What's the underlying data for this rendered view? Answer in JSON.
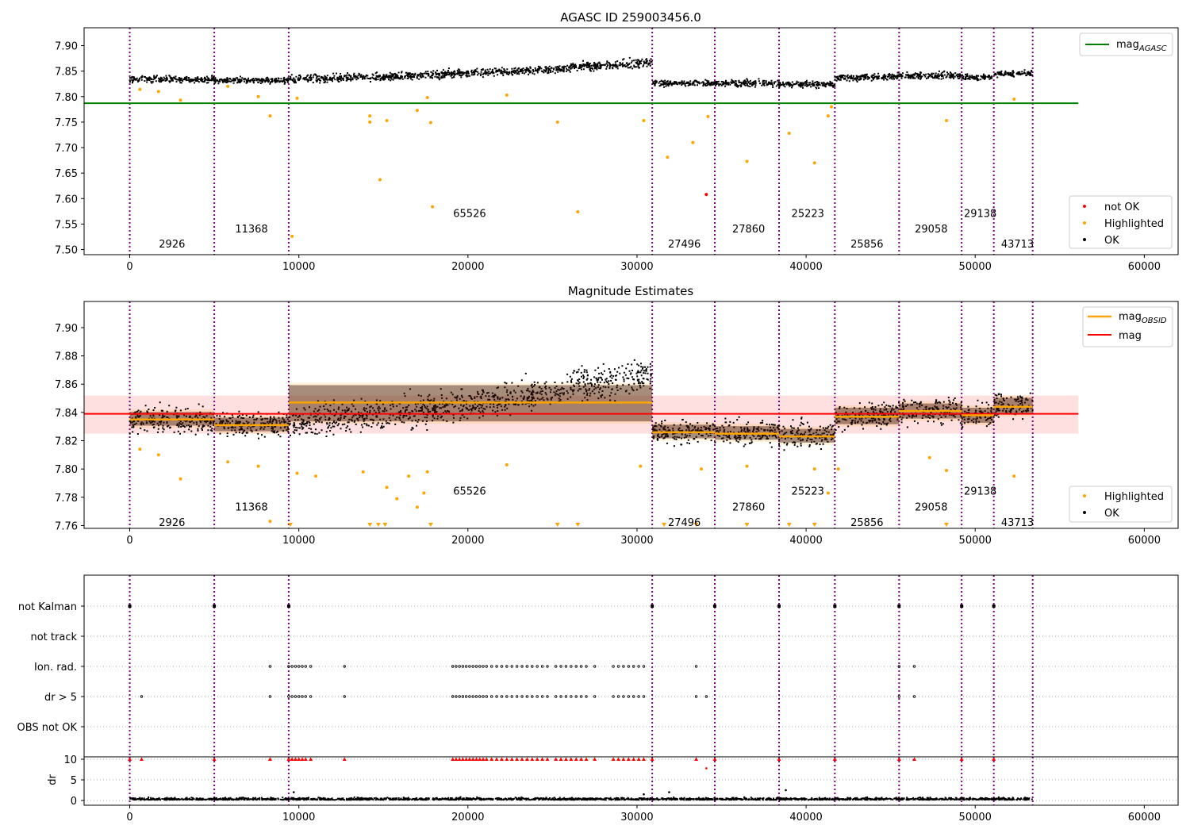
{
  "figure": {
    "panel1_title": "AGASC ID 259003456.0",
    "panel2_title": "Magnitude Estimates",
    "x_ticks": [
      0,
      10000,
      20000,
      30000,
      40000,
      50000,
      60000
    ]
  },
  "chart_data": [
    {
      "type": "scatter",
      "title": "AGASC ID 259003456.0",
      "xlim": [
        -2700,
        62000
      ],
      "ylim": [
        7.49,
        7.935
      ],
      "y_ticks": [
        "7.50",
        "7.55",
        "7.60",
        "7.65",
        "7.70",
        "7.75",
        "7.80",
        "7.85",
        "7.90"
      ],
      "mag_agasc": 7.787,
      "obs_boundaries": [
        0,
        5000,
        9400,
        30900,
        34600,
        38400,
        41700,
        45500,
        49200,
        51100,
        53400
      ],
      "obs_labels": [
        {
          "text": "2926",
          "x": 2500,
          "y": 7.51
        },
        {
          "text": "11368",
          "x": 7200,
          "y": 7.54
        },
        {
          "text": "65526",
          "x": 20100,
          "y": 7.57
        },
        {
          "text": "27496",
          "x": 32800,
          "y": 7.51
        },
        {
          "text": "27860",
          "x": 36600,
          "y": 7.54
        },
        {
          "text": "25223",
          "x": 40100,
          "y": 7.57
        },
        {
          "text": "25856",
          "x": 43600,
          "y": 7.51
        },
        {
          "text": "29058",
          "x": 47400,
          "y": 7.54
        },
        {
          "text": "29138",
          "x": 50300,
          "y": 7.57
        },
        {
          "text": "43713",
          "x": 52500,
          "y": 7.51
        }
      ],
      "segments": [
        {
          "x0": 0,
          "x1": 5000,
          "y0": 7.834,
          "y1": 7.834,
          "spread": 0.009
        },
        {
          "x0": 5000,
          "x1": 9400,
          "y0": 7.832,
          "y1": 7.832,
          "spread": 0.008
        },
        {
          "x0": 9400,
          "x1": 16000,
          "y0": 7.833,
          "y1": 7.84,
          "spread": 0.011
        },
        {
          "x0": 16000,
          "x1": 26000,
          "y0": 7.84,
          "y1": 7.855,
          "spread": 0.011
        },
        {
          "x0": 26000,
          "x1": 30900,
          "y0": 7.858,
          "y1": 7.867,
          "spread": 0.012
        },
        {
          "x0": 30900,
          "x1": 34600,
          "y0": 7.826,
          "y1": 7.826,
          "spread": 0.008
        },
        {
          "x0": 34600,
          "x1": 38400,
          "y0": 7.826,
          "y1": 7.826,
          "spread": 0.009
        },
        {
          "x0": 38400,
          "x1": 41700,
          "y0": 7.824,
          "y1": 7.824,
          "spread": 0.009
        },
        {
          "x0": 41700,
          "x1": 45500,
          "y0": 7.836,
          "y1": 7.84,
          "spread": 0.009
        },
        {
          "x0": 45500,
          "x1": 49200,
          "y0": 7.841,
          "y1": 7.841,
          "spread": 0.009
        },
        {
          "x0": 49200,
          "x1": 51100,
          "y0": 7.838,
          "y1": 7.838,
          "spread": 0.008
        },
        {
          "x0": 51100,
          "x1": 53400,
          "y0": 7.845,
          "y1": 7.845,
          "spread": 0.009
        }
      ],
      "highlighted": [
        [
          600,
          7.814
        ],
        [
          1700,
          7.81
        ],
        [
          3000,
          7.793
        ],
        [
          5800,
          7.82
        ],
        [
          7600,
          7.8
        ],
        [
          8300,
          7.762
        ],
        [
          9600,
          7.526
        ],
        [
          9900,
          7.797
        ],
        [
          14200,
          7.762
        ],
        [
          14200,
          7.75
        ],
        [
          14800,
          7.637
        ],
        [
          15200,
          7.753
        ],
        [
          17000,
          7.773
        ],
        [
          17600,
          7.798
        ],
        [
          17800,
          7.749
        ],
        [
          17900,
          7.584
        ],
        [
          22300,
          7.803
        ],
        [
          25300,
          7.75
        ],
        [
          26500,
          7.574
        ],
        [
          30400,
          7.753
        ],
        [
          31800,
          7.681
        ],
        [
          33300,
          7.71
        ],
        [
          34200,
          7.761
        ],
        [
          36500,
          7.673
        ],
        [
          39000,
          7.728
        ],
        [
          40500,
          7.67
        ],
        [
          41300,
          7.762
        ],
        [
          41500,
          7.78
        ],
        [
          48300,
          7.753
        ],
        [
          52300,
          7.795
        ]
      ],
      "not_ok": [
        [
          34100,
          7.608
        ]
      ],
      "legend_top": [
        "mag"
      ],
      "legend_top_sub": "AGASC",
      "legend_bottom": [
        "not OK",
        "Highlighted",
        "OK"
      ]
    },
    {
      "type": "scatter",
      "title": "Magnitude Estimates",
      "xlim": [
        -2700,
        62000
      ],
      "ylim": [
        7.758,
        7.9185
      ],
      "y_ticks": [
        "7.76",
        "7.78",
        "7.80",
        "7.82",
        "7.84",
        "7.86",
        "7.88",
        "7.90"
      ],
      "mag": 7.839,
      "mag_band": [
        7.825,
        7.852
      ],
      "obs_labels": [
        {
          "text": "2926",
          "x": 2500,
          "y": 7.762
        },
        {
          "text": "11368",
          "x": 7200,
          "y": 7.773
        },
        {
          "text": "65526",
          "x": 20100,
          "y": 7.784
        },
        {
          "text": "27496",
          "x": 32800,
          "y": 7.762
        },
        {
          "text": "27860",
          "x": 36600,
          "y": 7.773
        },
        {
          "text": "25223",
          "x": 40100,
          "y": 7.784
        },
        {
          "text": "25856",
          "x": 43600,
          "y": 7.762
        },
        {
          "text": "29058",
          "x": 47400,
          "y": 7.773
        },
        {
          "text": "29138",
          "x": 50300,
          "y": 7.784
        },
        {
          "text": "43713",
          "x": 52500,
          "y": 7.762
        }
      ],
      "mag_obsid": [
        {
          "x0": 0,
          "x1": 5000,
          "y": 7.835,
          "lo": 7.829,
          "hi": 7.842
        },
        {
          "x0": 5000,
          "x1": 9400,
          "y": 7.831,
          "lo": 7.825,
          "hi": 7.838
        },
        {
          "x0": 9400,
          "x1": 30900,
          "y": 7.847,
          "lo": 7.832,
          "hi": 7.861
        },
        {
          "x0": 30900,
          "x1": 34600,
          "y": 7.826,
          "lo": 7.82,
          "hi": 7.833
        },
        {
          "x0": 34600,
          "x1": 38400,
          "y": 7.825,
          "lo": 7.819,
          "hi": 7.832
        },
        {
          "x0": 38400,
          "x1": 41700,
          "y": 7.823,
          "lo": 7.817,
          "hi": 7.83
        },
        {
          "x0": 41700,
          "x1": 45500,
          "y": 7.837,
          "lo": 7.83,
          "hi": 7.845
        },
        {
          "x0": 45500,
          "x1": 49200,
          "y": 7.841,
          "lo": 7.834,
          "hi": 7.848
        },
        {
          "x0": 49200,
          "x1": 51100,
          "y": 7.838,
          "lo": 7.831,
          "hi": 7.845
        },
        {
          "x0": 51100,
          "x1": 53400,
          "y": 7.844,
          "lo": 7.837,
          "hi": 7.852
        }
      ],
      "highlighted": [
        [
          600,
          7.814
        ],
        [
          1700,
          7.81
        ],
        [
          3000,
          7.793
        ],
        [
          5800,
          7.805
        ],
        [
          7600,
          7.802
        ],
        [
          8300,
          7.763
        ],
        [
          9900,
          7.797
        ],
        [
          11000,
          7.795
        ],
        [
          13800,
          7.798
        ],
        [
          15200,
          7.787
        ],
        [
          15800,
          7.779
        ],
        [
          16500,
          7.795
        ],
        [
          17000,
          7.773
        ],
        [
          17400,
          7.783
        ],
        [
          17600,
          7.798
        ],
        [
          22300,
          7.803
        ],
        [
          30200,
          7.802
        ],
        [
          33800,
          7.8
        ],
        [
          36500,
          7.802
        ],
        [
          40500,
          7.8
        ],
        [
          41300,
          7.783
        ],
        [
          41900,
          7.8
        ],
        [
          47300,
          7.808
        ],
        [
          48300,
          7.799
        ],
        [
          52300,
          7.795
        ]
      ],
      "clipped_low": [
        9500,
        14200,
        14700,
        15100,
        17800,
        25300,
        26500,
        31600,
        33500,
        36500,
        39000,
        40500,
        48300
      ],
      "legend_top": [
        "mag",
        "mag"
      ],
      "legend_top_sub": "OBSID",
      "legend_bottom": [
        "Highlighted",
        "OK"
      ]
    },
    {
      "type": "scatter",
      "title": "",
      "xlim": [
        -2700,
        62000
      ],
      "flag_rows": [
        "not Kalman",
        "not track",
        "Ion. rad.",
        "dr > 5",
        "OBS not OK"
      ],
      "dr_ticks": [
        "10",
        "5",
        "0"
      ],
      "dr_ylabel": "dr",
      "not_kalman_x": [
        0,
        5000,
        9400,
        30900,
        34600,
        38400,
        41700,
        45500,
        49200,
        51100
      ],
      "ion_rad_x": [
        8300,
        9400,
        9600,
        9800,
        10000,
        10200,
        10400,
        10700,
        12700,
        19100,
        19300,
        19500,
        19700,
        19900,
        20100,
        20300,
        20500,
        20700,
        20900,
        21100,
        21400,
        21700,
        22000,
        22300,
        22600,
        22900,
        23200,
        23500,
        23800,
        24100,
        24400,
        24700,
        25200,
        25500,
        25800,
        26100,
        26400,
        26700,
        27000,
        27500,
        28600,
        28900,
        29200,
        29500,
        29800,
        30100,
        30400,
        33500,
        45500,
        46400
      ],
      "dr5_extra_x": [
        700,
        34100
      ],
      "dr_spikes": [
        [
          700,
          10
        ],
        [
          34100,
          7.8
        ],
        [
          9700,
          2
        ],
        [
          30400,
          1.5
        ],
        [
          31900,
          2
        ],
        [
          38800,
          2.5
        ]
      ]
    }
  ]
}
